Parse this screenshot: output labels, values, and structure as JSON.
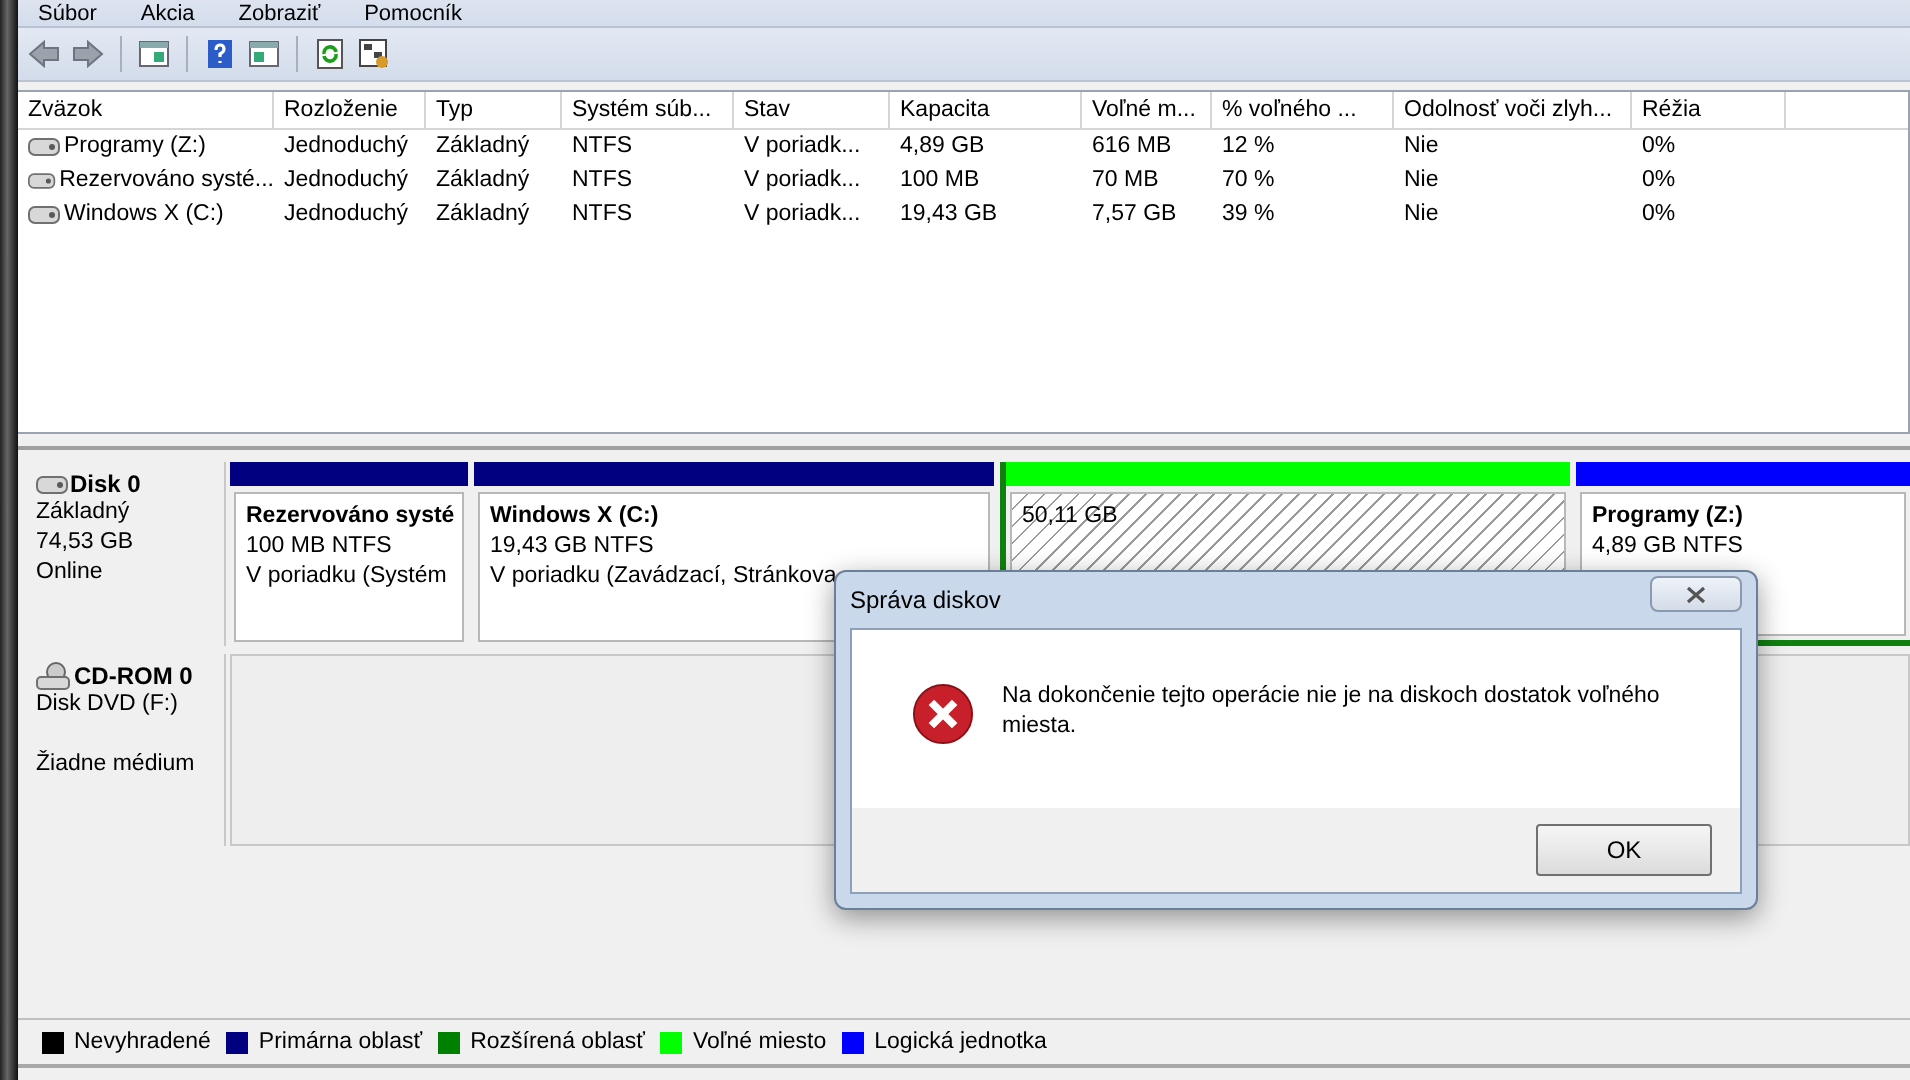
{
  "menu": [
    {
      "label": "Súbor"
    },
    {
      "label": "Akcia"
    },
    {
      "label": "Zobraziť"
    },
    {
      "label": "Pomocník"
    }
  ],
  "volumes": {
    "columns": [
      "Zväzok",
      "Rozloženie",
      "Typ",
      "Systém súb...",
      "Stav",
      "Kapacita",
      "Voľné m...",
      "% voľného ...",
      "Odolnosť voči zlyh...",
      "Réžia"
    ],
    "rows": [
      {
        "cells": [
          "Programy (Z:)",
          "Jednoduchý",
          "Základný",
          "NTFS",
          "V poriadk...",
          "4,89 GB",
          "616 MB",
          "12 %",
          "Nie",
          "0%"
        ]
      },
      {
        "cells": [
          "Rezervováno systé...",
          "Jednoduchý",
          "Základný",
          "NTFS",
          "V poriadk...",
          "100 MB",
          "70 MB",
          "70 %",
          "Nie",
          "0%"
        ]
      },
      {
        "cells": [
          "Windows X (C:)",
          "Jednoduchý",
          "Základný",
          "NTFS",
          "V poriadk...",
          "19,43 GB",
          "7,57 GB",
          "39 %",
          "Nie",
          "0%"
        ]
      }
    ]
  },
  "disks": [
    {
      "kind": "hdd",
      "name": "Disk 0",
      "details": [
        "Základný",
        "74,53 GB",
        "Online"
      ],
      "partitions": [
        {
          "kind": "primary",
          "title": "Rezervováno systé",
          "lines": [
            "100 MB NTFS",
            "V poriadku (Systém"
          ]
        },
        {
          "kind": "primary",
          "title": "Windows X  (C:)",
          "lines": [
            "19,43 GB NTFS",
            "V poriadku (Zavádzací, Stránkova"
          ]
        },
        {
          "kind": "extended",
          "children": [
            {
              "kind": "free",
              "lines": [
                "50,11 GB"
              ]
            },
            {
              "kind": "logical",
              "title": "Programy  (Z:)",
              "lines": [
                "4,89 GB NTFS"
              ]
            }
          ]
        }
      ]
    },
    {
      "kind": "cdrom",
      "name": "CD-ROM 0",
      "details": [
        "Disk DVD (F:)"
      ],
      "status": "Žiadne médium"
    }
  ],
  "legend": [
    {
      "label": "Nevyhradené",
      "color": "#000000"
    },
    {
      "label": "Primárna oblasť",
      "color": "#000080"
    },
    {
      "label": "Rozšírená oblasť",
      "color": "#008000"
    },
    {
      "label": "Voľné miesto",
      "color": "#00ff00"
    },
    {
      "label": "Logická jednotka",
      "color": "#0000ff"
    }
  ],
  "dialog": {
    "title": "Správa diskov",
    "message": "Na dokončenie tejto operácie nie je na diskoch dostatok voľného miesta.",
    "buttons": [
      "OK"
    ]
  }
}
